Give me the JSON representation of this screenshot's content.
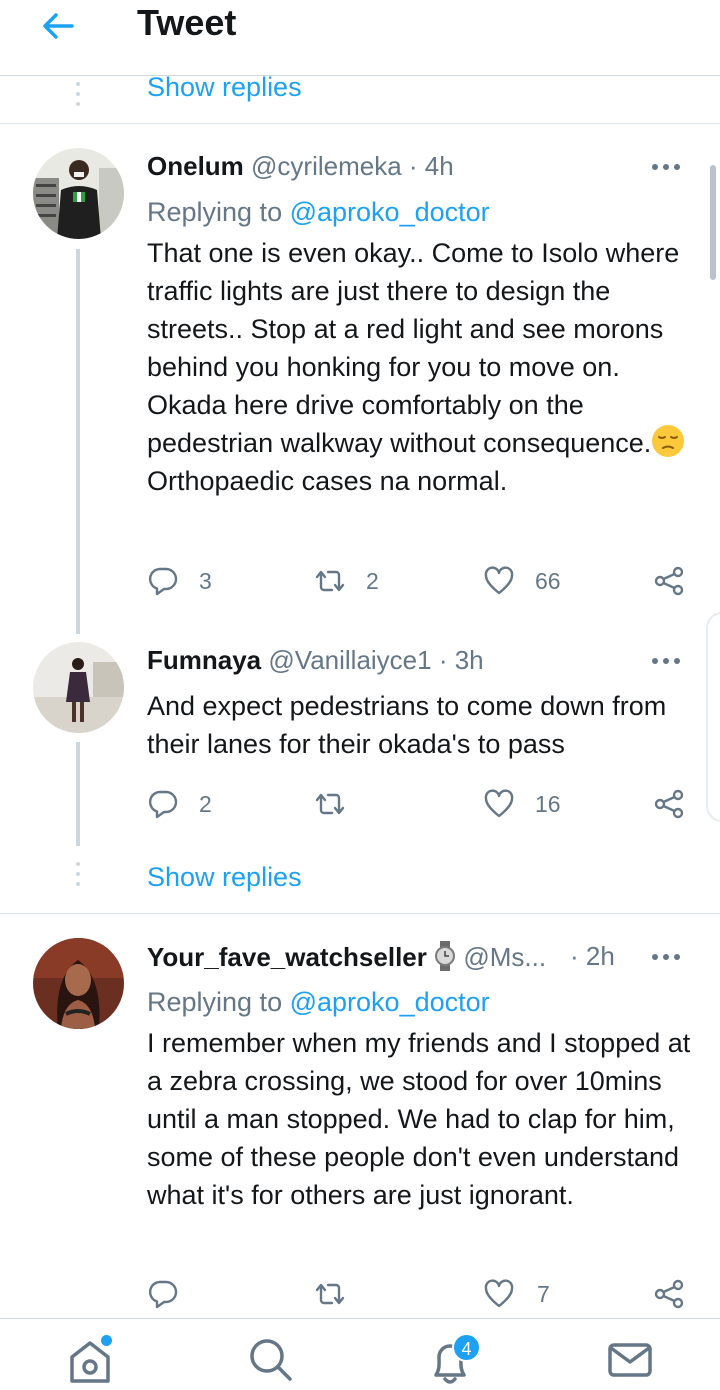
{
  "header": {
    "title": "Tweet"
  },
  "show_replies_label": "Show replies",
  "tweets": [
    {
      "name": "Onelum",
      "handle": "@cyrilemeka",
      "time": "· 4h",
      "replying_prefix": "Replying to",
      "replying_to": "@aproko_doctor",
      "text_before_emoji": "That one is even okay.. Come to Isolo where traffic lights are just there to design the streets.. Stop at a red light and see morons behind you honking for you to move on. Okada here drive comfortably on the pedestrian walkway without consequence.",
      "text_after_emoji": " Orthopaedic cases na normal.",
      "replies": "3",
      "retweets": "2",
      "likes": "66"
    },
    {
      "name": "Fumnaya",
      "handle": "@Vanillaiyce1",
      "time": "· 3h",
      "text": "And expect pedestrians to come down from their lanes for their okada's to pass",
      "replies": "2",
      "retweets": "",
      "likes": "16"
    },
    {
      "name": "Your_fave_watchseller",
      "handle": "@Ms...",
      "time": "· 2h",
      "replying_prefix": "Replying to",
      "replying_to": "@aproko_doctor",
      "text": "I remember when my friends and I stopped at a zebra crossing, we stood for over 10mins until a man stopped. We had to clap for him, some of these people don't even understand what it's for others are just ignorant.",
      "replies": "",
      "retweets": "",
      "likes": "7"
    }
  ],
  "bottom_nav": {
    "notifications_badge": "4"
  },
  "colors": {
    "accent": "#1da1f2",
    "secondary_text": "#657786",
    "primary_text": "#14171a",
    "divider": "#e1e8ed"
  },
  "icons": [
    "back-arrow-icon",
    "more-icon",
    "reply-icon",
    "retweet-icon",
    "like-icon",
    "share-icon",
    "home-icon",
    "search-icon",
    "notifications-icon",
    "messages-icon",
    "pensive-emoji-icon",
    "watch-emoji-icon"
  ]
}
